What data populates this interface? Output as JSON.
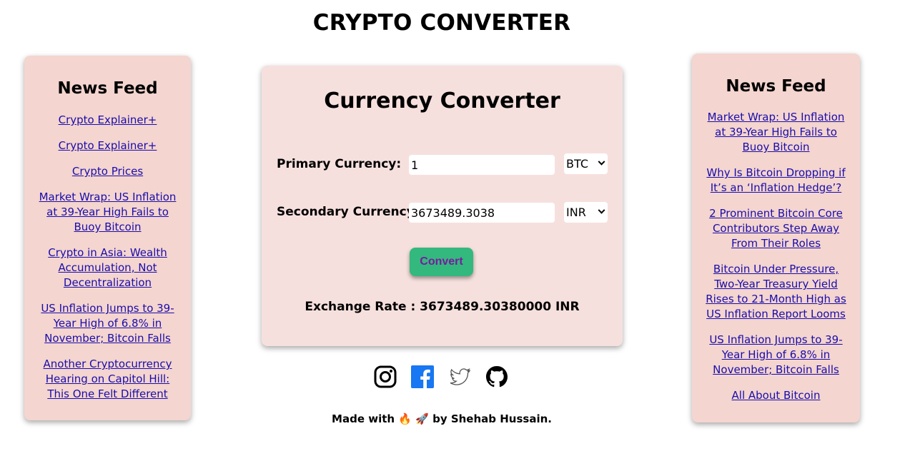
{
  "header": {
    "title": "CRYPTO CONVERTER"
  },
  "left_news": {
    "heading": "News Feed",
    "items": [
      "Crypto Explainer+",
      "Crypto Explainer+",
      "Crypto Prices",
      "Market Wrap: US Inflation at 39-Year High Fails to Buoy Bitcoin",
      "Crypto in Asia: Wealth Accumulation, Not Decentralization",
      "US Inflation Jumps to 39-Year High of 6.8% in November; Bitcoin Falls",
      "Another Cryptocurrency Hearing on Capitol Hill: This One Felt Different"
    ]
  },
  "converter": {
    "title": "Currency Converter",
    "primary_label": "Primary Currency:",
    "primary_value": "1",
    "primary_currency": "BTC",
    "secondary_label": "Secondary Currency:",
    "secondary_value": "3673489.3038",
    "secondary_currency": "INR",
    "convert_label": "Convert",
    "exchange_rate_text": "Exchange Rate : 3673489.30380000 INR"
  },
  "right_news": {
    "heading": "News Feed",
    "items": [
      "Market Wrap: US Inflation at 39-Year High Fails to Buoy Bitcoin",
      "Why Is Bitcoin Dropping if It’s an ‘Inflation Hedge’?",
      "2 Prominent Bitcoin Core Contributors Step Away From Their Roles",
      "Bitcoin Under Pressure, Two-Year Treasury Yield Rises to 21-Month High as US Inflation Report Looms",
      "US Inflation Jumps to 39-Year High of 6.8% in November; Bitcoin Falls",
      "All About Bitcoin"
    ]
  },
  "socials": {
    "icons": [
      "instagram-icon",
      "facebook-icon",
      "twitter-icon",
      "github-icon"
    ]
  },
  "footer": {
    "text": "Made with 🔥 🚀 by Shehab Hussain."
  },
  "colors": {
    "panel_bg": "#f4d5cf",
    "converter_bg": "#f6e0dd",
    "button_bg": "#33b97e",
    "button_text": "#7a1aa0",
    "link": "#1a0dab",
    "facebook": "#1877f2"
  }
}
